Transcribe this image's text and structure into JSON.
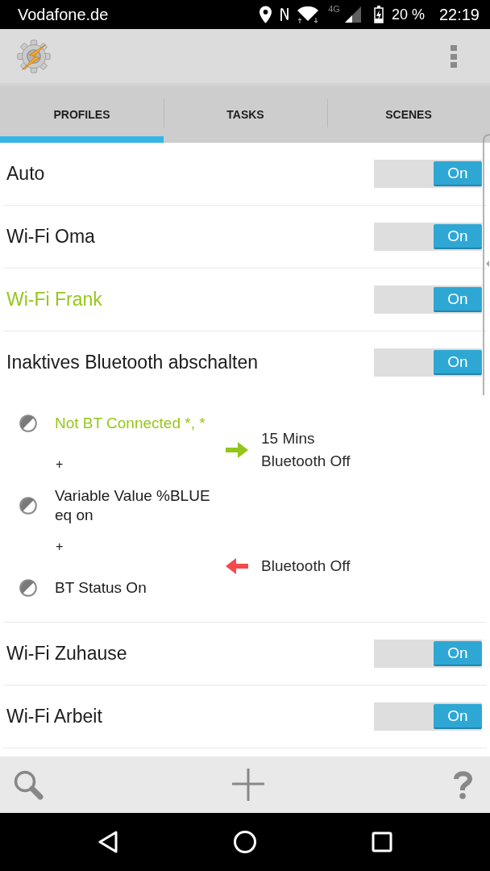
{
  "status_bar": {
    "carrier": "Vodafone.de",
    "network": "4G",
    "battery": "20 %",
    "time": "22:19"
  },
  "tabs": [
    {
      "label": "PROFILES",
      "selected": true
    },
    {
      "label": "TASKS",
      "selected": false
    },
    {
      "label": "SCENES",
      "selected": false
    }
  ],
  "profiles": [
    {
      "name": "Auto",
      "active": false,
      "expanded": false,
      "on": true,
      "switch_label": "On"
    },
    {
      "name": "Wi-Fi Oma",
      "active": false,
      "expanded": false,
      "on": true,
      "switch_label": "On"
    },
    {
      "name": "Wi-Fi Frank",
      "active": true,
      "expanded": false,
      "on": true,
      "switch_label": "On"
    },
    {
      "name": "Inaktives Bluetooth abschalten",
      "active": false,
      "expanded": true,
      "on": true,
      "switch_label": "On",
      "contexts": [
        {
          "kind": "context",
          "label": "Not BT Connected *, *",
          "active": true
        },
        {
          "kind": "joiner",
          "label": "+"
        },
        {
          "kind": "context",
          "label": "Variable Value %BLUE eq on",
          "active": false
        },
        {
          "kind": "joiner",
          "label": "+"
        },
        {
          "kind": "context",
          "label": "BT Status On",
          "active": false
        }
      ],
      "tasks": [
        {
          "kind": "enter",
          "label": "15 Mins Bluetooth Off"
        },
        {
          "kind": "exit",
          "label": "Bluetooth Off"
        }
      ]
    },
    {
      "name": "Wi-Fi Zuhause",
      "active": false,
      "expanded": false,
      "on": true,
      "switch_label": "On"
    },
    {
      "name": "Wi-Fi Arbeit",
      "active": false,
      "expanded": false,
      "on": true,
      "switch_label": "On"
    }
  ]
}
